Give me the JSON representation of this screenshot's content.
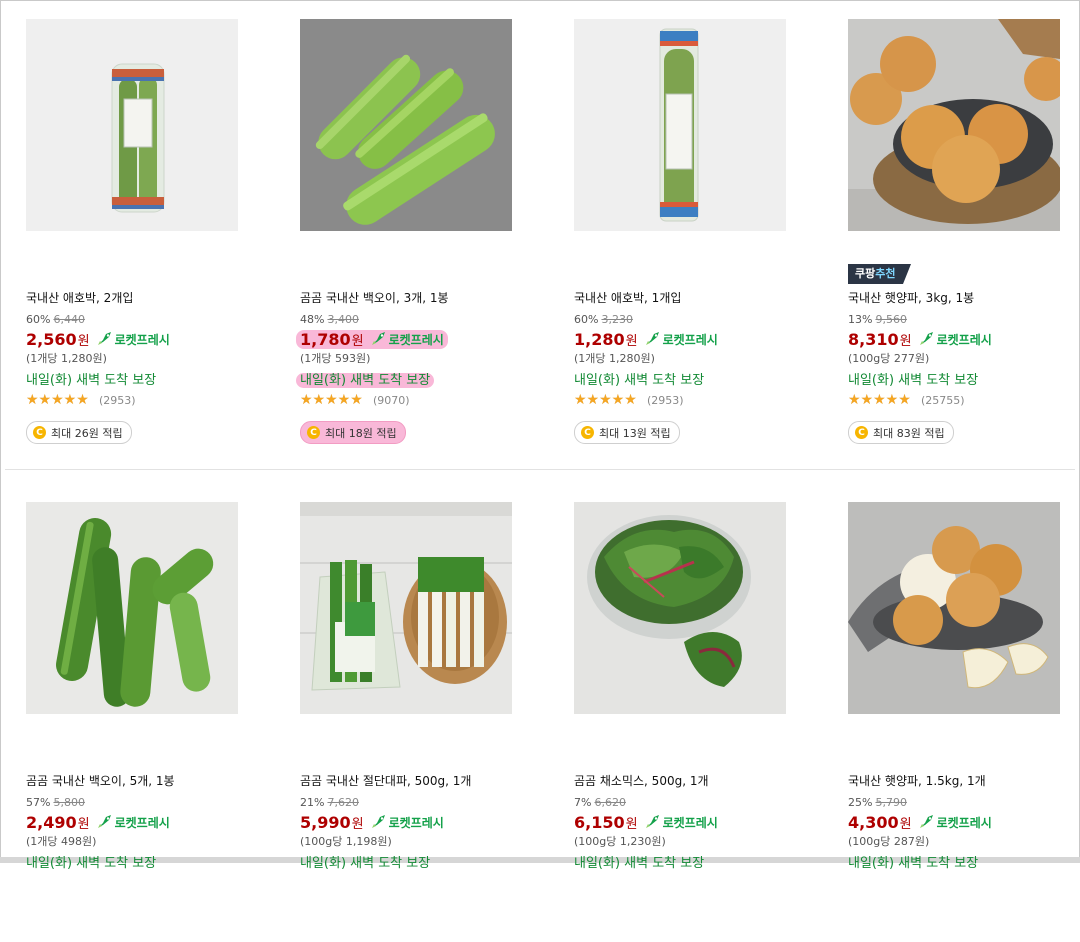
{
  "rocket_label": "로켓프레시",
  "products": [
    {
      "name": "국내산 애호박, 2개입",
      "discount": "60%",
      "original_price": "6,440",
      "price": "2,560",
      "currency": "원",
      "unit_price": "(1개당 1,280원)",
      "delivery": "내일(화) 새벽 도착 보장",
      "rating": 5.0,
      "review_count": "(2953)",
      "reward": "최대 26원 적립",
      "badge": null,
      "highlighted": false
    },
    {
      "name": "곰곰 국내산 백오이, 3개, 1봉",
      "discount": "48%",
      "original_price": "3,400",
      "price": "1,780",
      "currency": "원",
      "unit_price": "(1개당 593원)",
      "delivery": "내일(화) 새벽 도착 보장",
      "rating": 4.5,
      "review_count": "(9070)",
      "reward": "최대 18원 적립",
      "badge": null,
      "highlighted": true
    },
    {
      "name": "국내산 애호박, 1개입",
      "discount": "60%",
      "original_price": "3,230",
      "price": "1,280",
      "currency": "원",
      "unit_price": "(1개당 1,280원)",
      "delivery": "내일(화) 새벽 도착 보장",
      "rating": 5.0,
      "review_count": "(2953)",
      "reward": "최대 13원 적립",
      "badge": null,
      "highlighted": false
    },
    {
      "name": "국내산 햇양파, 3kg, 1봉",
      "discount": "13%",
      "original_price": "9,560",
      "price": "8,310",
      "currency": "원",
      "unit_price": "(100g당 277원)",
      "delivery": "내일(화) 새벽 도착 보장",
      "rating": 4.5,
      "review_count": "(25755)",
      "reward": "최대 83원 적립",
      "badge": {
        "part1": "쿠팡",
        "part2": "추천"
      },
      "highlighted": false
    },
    {
      "name": "곰곰 국내산 백오이, 5개, 1봉",
      "discount": "57%",
      "original_price": "5,800",
      "price": "2,490",
      "currency": "원",
      "unit_price": "(1개당 498원)",
      "delivery": "내일(화) 새벽 도착 보장",
      "badge": null,
      "highlighted": false
    },
    {
      "name": "곰곰 국내산 절단대파, 500g, 1개",
      "discount": "21%",
      "original_price": "7,620",
      "price": "5,990",
      "currency": "원",
      "unit_price": "(100g당 1,198원)",
      "delivery": "내일(화) 새벽 도착 보장",
      "badge": null,
      "highlighted": false
    },
    {
      "name": "곰곰 채소믹스, 500g, 1개",
      "discount": "7%",
      "original_price": "6,620",
      "price": "6,150",
      "currency": "원",
      "unit_price": "(100g당 1,230원)",
      "delivery": "내일(화) 새벽 도착 보장",
      "badge": null,
      "highlighted": false
    },
    {
      "name": "국내산 햇양파, 1.5kg, 1개",
      "discount": "25%",
      "original_price": "5,790",
      "price": "4,300",
      "currency": "원",
      "unit_price": "(100g당 287원)",
      "delivery": "내일(화) 새벽 도착 보장",
      "badge": null,
      "highlighted": false
    }
  ]
}
